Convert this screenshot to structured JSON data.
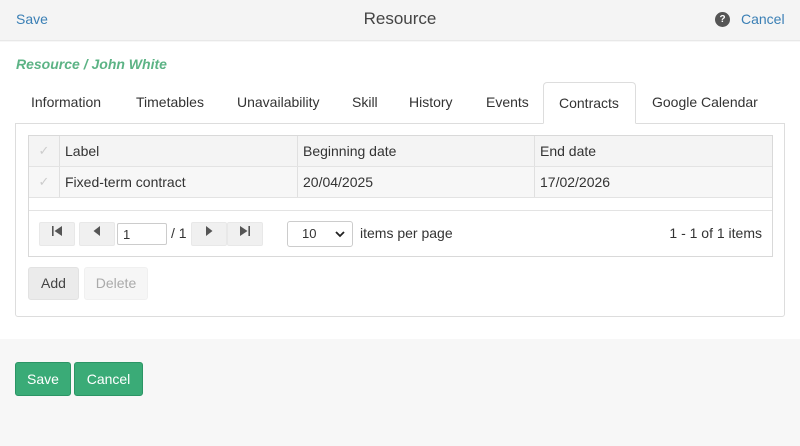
{
  "header": {
    "save_label": "Save",
    "title": "Resource",
    "help_glyph": "?",
    "cancel_label": "Cancel"
  },
  "breadcrumb": "Resource / John White",
  "tabs": [
    {
      "label": "Information",
      "active": false
    },
    {
      "label": "Timetables",
      "active": false
    },
    {
      "label": "Unavailability",
      "active": false
    },
    {
      "label": "Skill",
      "active": false
    },
    {
      "label": "History",
      "active": false
    },
    {
      "label": "Events",
      "active": false
    },
    {
      "label": "Contracts",
      "active": true
    },
    {
      "label": "Google Calendar",
      "active": false
    }
  ],
  "grid": {
    "columns": [
      "Label",
      "Beginning date",
      "End date"
    ],
    "rows": [
      {
        "label": "Fixed-term contract",
        "beginning": "20/04/2025",
        "end": "17/02/2026"
      }
    ],
    "pager": {
      "page": "1",
      "total_pages": "/ 1",
      "page_size": "10",
      "page_size_label": "items per page",
      "info": "1 - 1 of 1 items"
    }
  },
  "actions": {
    "add_label": "Add",
    "delete_label": "Delete"
  },
  "footer": {
    "save_label": "Save",
    "cancel_label": "Cancel"
  },
  "colors": {
    "link": "#3a7fb5",
    "breadcrumb": "#5cb385",
    "primary_button": "#3aab77"
  },
  "icons": {
    "check": "check-icon",
    "first": "first-page-icon",
    "prev": "prev-page-icon",
    "next": "next-page-icon",
    "last": "last-page-icon"
  }
}
